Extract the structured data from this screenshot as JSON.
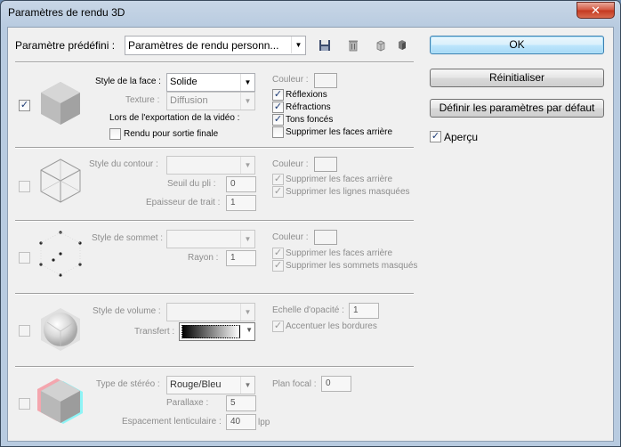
{
  "window": {
    "title": "Paramètres de rendu 3D",
    "close_glyph": "✕"
  },
  "preset": {
    "label": "Paramètre prédéfini :",
    "value": "Paramètres de rendu personn...",
    "icons": [
      "save-icon",
      "delete-icon",
      "new-icon",
      "load-icon"
    ]
  },
  "buttons": {
    "ok": "OK",
    "reset": "Réinitialiser",
    "default": "Définir les paramètres par défaut"
  },
  "preview": {
    "label": "Aperçu",
    "checked": true
  },
  "face": {
    "enabled": true,
    "style_label": "Style de la face :",
    "style_value": "Solide",
    "texture_label": "Texture :",
    "texture_value": "Diffusion",
    "export_label": "Lors de l'exportation de la vidéo :",
    "final_render_label": "Rendu pour sortie finale",
    "color_label": "Couleur :",
    "checks": [
      {
        "label": "Réflexions",
        "checked": true
      },
      {
        "label": "Réfractions",
        "checked": true
      },
      {
        "label": "Tons foncés",
        "checked": true
      },
      {
        "label": "Supprimer les faces arrière",
        "checked": false
      }
    ]
  },
  "contour": {
    "style_label": "Style du contour :",
    "crease_label": "Seuil du pli :",
    "crease_value": "0",
    "width_label": "Epaisseur de trait :",
    "width_value": "1",
    "color_label": "Couleur :",
    "checks": [
      {
        "label": "Supprimer les faces arrière",
        "checked": true
      },
      {
        "label": "Supprimer les lignes masquées",
        "checked": true
      }
    ]
  },
  "vertex": {
    "style_label": "Style de sommet :",
    "radius_label": "Rayon :",
    "radius_value": "1",
    "color_label": "Couleur :",
    "checks": [
      {
        "label": "Supprimer les faces arrière",
        "checked": true
      },
      {
        "label": "Supprimer les sommets masqués",
        "checked": true
      }
    ]
  },
  "volume": {
    "style_label": "Style de volume :",
    "transfer_label": "Transfert :",
    "opacity_label": "Echelle d'opacité :",
    "opacity_value": "1",
    "checks": [
      {
        "label": "Accentuer les bordures",
        "checked": true
      }
    ]
  },
  "stereo": {
    "type_label": "Type de stéréo :",
    "type_value": "Rouge/Bleu",
    "parallax_label": "Parallaxe :",
    "parallax_value": "5",
    "lenticular_label": "Espacement lenticulaire :",
    "lenticular_value": "40",
    "lenticular_unit": "lpp",
    "focal_label": "Plan focal :",
    "focal_value": "0"
  }
}
